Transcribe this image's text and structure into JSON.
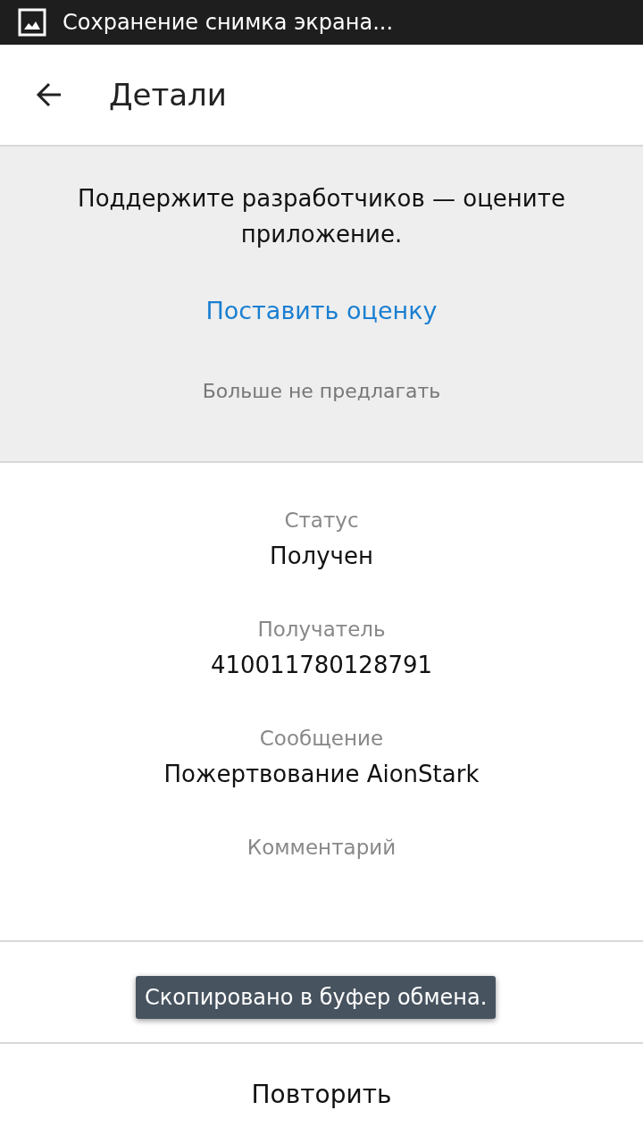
{
  "status_bar": {
    "notification": "Сохранение снимка экрана..."
  },
  "app_bar": {
    "title": "Детали"
  },
  "rate_card": {
    "message": "Поддержите разработчиков — оцените приложение.",
    "rate_button": "Поставить оценку",
    "dismiss_button": "Больше не предлагать"
  },
  "details": [
    {
      "label": "Статус",
      "value": "Получен"
    },
    {
      "label": "Получатель",
      "value": "410011780128791"
    },
    {
      "label": "Сообщение",
      "value": "Пожертвование AionStark"
    },
    {
      "label": "Комментарий"
    }
  ],
  "actions": {
    "repeat_button": "Повторить"
  },
  "toast": "Скопировано в буфер обмена."
}
